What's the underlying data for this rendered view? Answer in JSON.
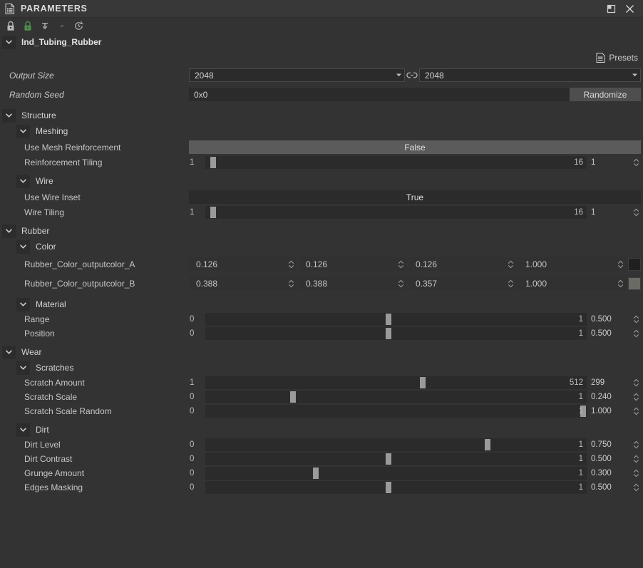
{
  "window": {
    "title": "PARAMETERS",
    "doc_icon": "document-list-icon",
    "restore_label": "restore-icon",
    "close_label": "close-icon"
  },
  "toolbar": {
    "items": [
      {
        "icon": "lock-icon",
        "state": "inactive"
      },
      {
        "icon": "lock-green-icon",
        "state": "active"
      },
      {
        "icon": "pin-down-icon",
        "state": "inactive"
      },
      {
        "icon": "small-dot-icon",
        "state": "disabled"
      },
      {
        "icon": "reset-clock-icon",
        "state": "inactive"
      }
    ]
  },
  "root": {
    "label": "Ind_Tubing_Rubber",
    "presets_label": "Presets",
    "presets_icon": "presets-list-icon"
  },
  "base": {
    "output_size": {
      "label": "Output Size",
      "width_value": "2048",
      "height_value": "2048",
      "link_icon": "link-chain-icon"
    },
    "random_seed": {
      "label": "Random Seed",
      "value": "0x0",
      "button_label": "Randomize"
    }
  },
  "groups": [
    {
      "name": "Structure",
      "subgroups": [
        {
          "name": "Meshing",
          "params": [
            {
              "label": "Use Mesh Reinforcement",
              "type": "bool",
              "value": "False"
            },
            {
              "label": "Reinforcement Tiling",
              "type": "slider",
              "min": "1",
              "max": "16",
              "value": "1",
              "fill": 2
            }
          ]
        },
        {
          "name": "Wire",
          "params": [
            {
              "label": "Use Wire Inset",
              "type": "bool",
              "value": "True"
            },
            {
              "label": "Wire Tiling",
              "type": "slider",
              "min": "1",
              "max": "16",
              "value": "1",
              "fill": 2
            }
          ]
        }
      ]
    },
    {
      "name": "Rubber",
      "subgroups": [
        {
          "name": "Color",
          "params": [
            {
              "label": "Rubber_Color_outputcolor_A",
              "type": "color",
              "components": [
                "0.126",
                "0.126",
                "0.126",
                "1.000"
              ],
              "swatch": "#202020"
            },
            {
              "label": "Rubber_Color_outputcolor_B",
              "type": "color",
              "components": [
                "0.388",
                "0.388",
                "0.357",
                "1.000"
              ],
              "swatch": "#6b6b66"
            }
          ]
        },
        {
          "name": "Material",
          "params": [
            {
              "label": "Range",
              "type": "slider",
              "min": "0",
              "max": "1",
              "value": "0.500",
              "fill": 48
            },
            {
              "label": "Position",
              "type": "slider",
              "min": "0",
              "max": "1",
              "value": "0.500",
              "fill": 48
            }
          ]
        }
      ]
    },
    {
      "name": "Wear",
      "subgroups": [
        {
          "name": "Scratches",
          "params": [
            {
              "label": "Scratch Amount",
              "type": "slider",
              "min": "1",
              "max": "512",
              "value": "299",
              "fill": 57
            },
            {
              "label": "Scratch Scale",
              "type": "slider",
              "min": "0",
              "max": "1",
              "value": "0.240",
              "fill": 23
            },
            {
              "label": "Scratch Scale Random",
              "type": "slider",
              "min": "0",
              "max": "1",
              "value": "1.000",
              "fill": 99
            }
          ]
        },
        {
          "name": "Dirt",
          "params": [
            {
              "label": "Dirt Level",
              "type": "slider",
              "min": "0",
              "max": "1",
              "value": "0.750",
              "fill": 74
            },
            {
              "label": "Dirt Contrast",
              "type": "slider",
              "min": "0",
              "max": "1",
              "value": "0.500",
              "fill": 48
            },
            {
              "label": "Grunge Amount",
              "type": "slider",
              "min": "0",
              "max": "1",
              "value": "0.300",
              "fill": 29
            },
            {
              "label": "Edges Masking",
              "type": "slider",
              "min": "0",
              "max": "1",
              "value": "0.500",
              "fill": 48
            }
          ]
        }
      ]
    }
  ],
  "colors": {
    "window_bg": "#333333",
    "titlebar_bg": "#383838",
    "track_bg": "#2b2b2b",
    "handle": "#9a9a9a",
    "bool_false_bg": "#5b5b5b",
    "button_bg": "#4e4e4e",
    "accent_green": "#4c8a4c",
    "text": "#c8c8c8"
  }
}
